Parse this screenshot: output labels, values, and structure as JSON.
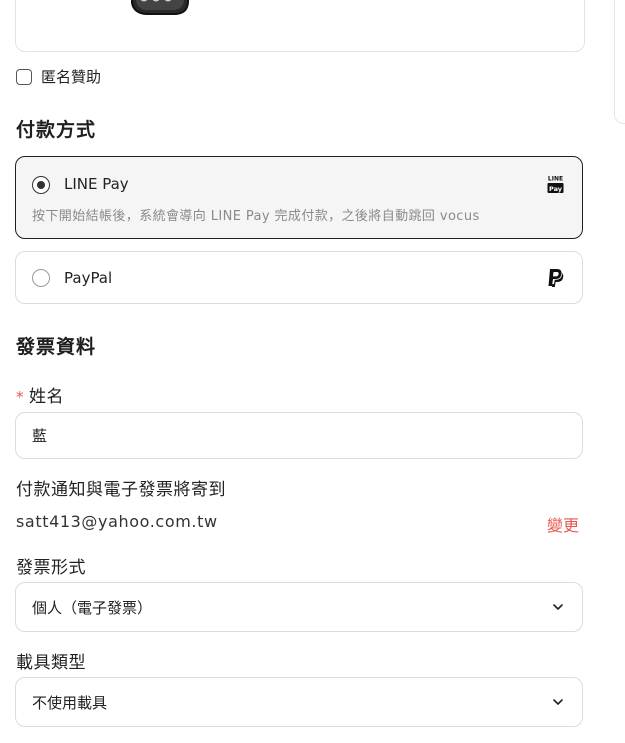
{
  "anonymous": {
    "label": "匿名贊助",
    "checked": false
  },
  "payment": {
    "title": "付款方式",
    "options": [
      {
        "name": "LINE Pay",
        "description": "按下開始結帳後，系統會導向 LINE Pay 完成付款，之後將自動跳回 vocus",
        "selected": true,
        "logo_text_top": "LINE",
        "logo_text_bottom": "Pay"
      },
      {
        "name": "PayPal",
        "selected": false
      }
    ]
  },
  "invoice": {
    "title": "發票資料",
    "name_label": "姓名",
    "required_mark": "*",
    "name_value": "藍",
    "notify_label": "付款通知與電子發票將寄到",
    "email": "satt413@yahoo.com.tw",
    "change_label": "變更",
    "format_label": "發票形式",
    "format_value": "個人（電子發票）",
    "carrier_label": "載具類型",
    "carrier_value": "不使用載具"
  },
  "colors": {
    "accent": "#e5574d",
    "selected_border": "#1f1f1f",
    "selected_bg": "#f5f5f5"
  },
  "icons": [
    "sticker-illustration-icon",
    "line-pay-logo-icon",
    "paypal-logo-icon",
    "chevron-down-icon"
  ]
}
